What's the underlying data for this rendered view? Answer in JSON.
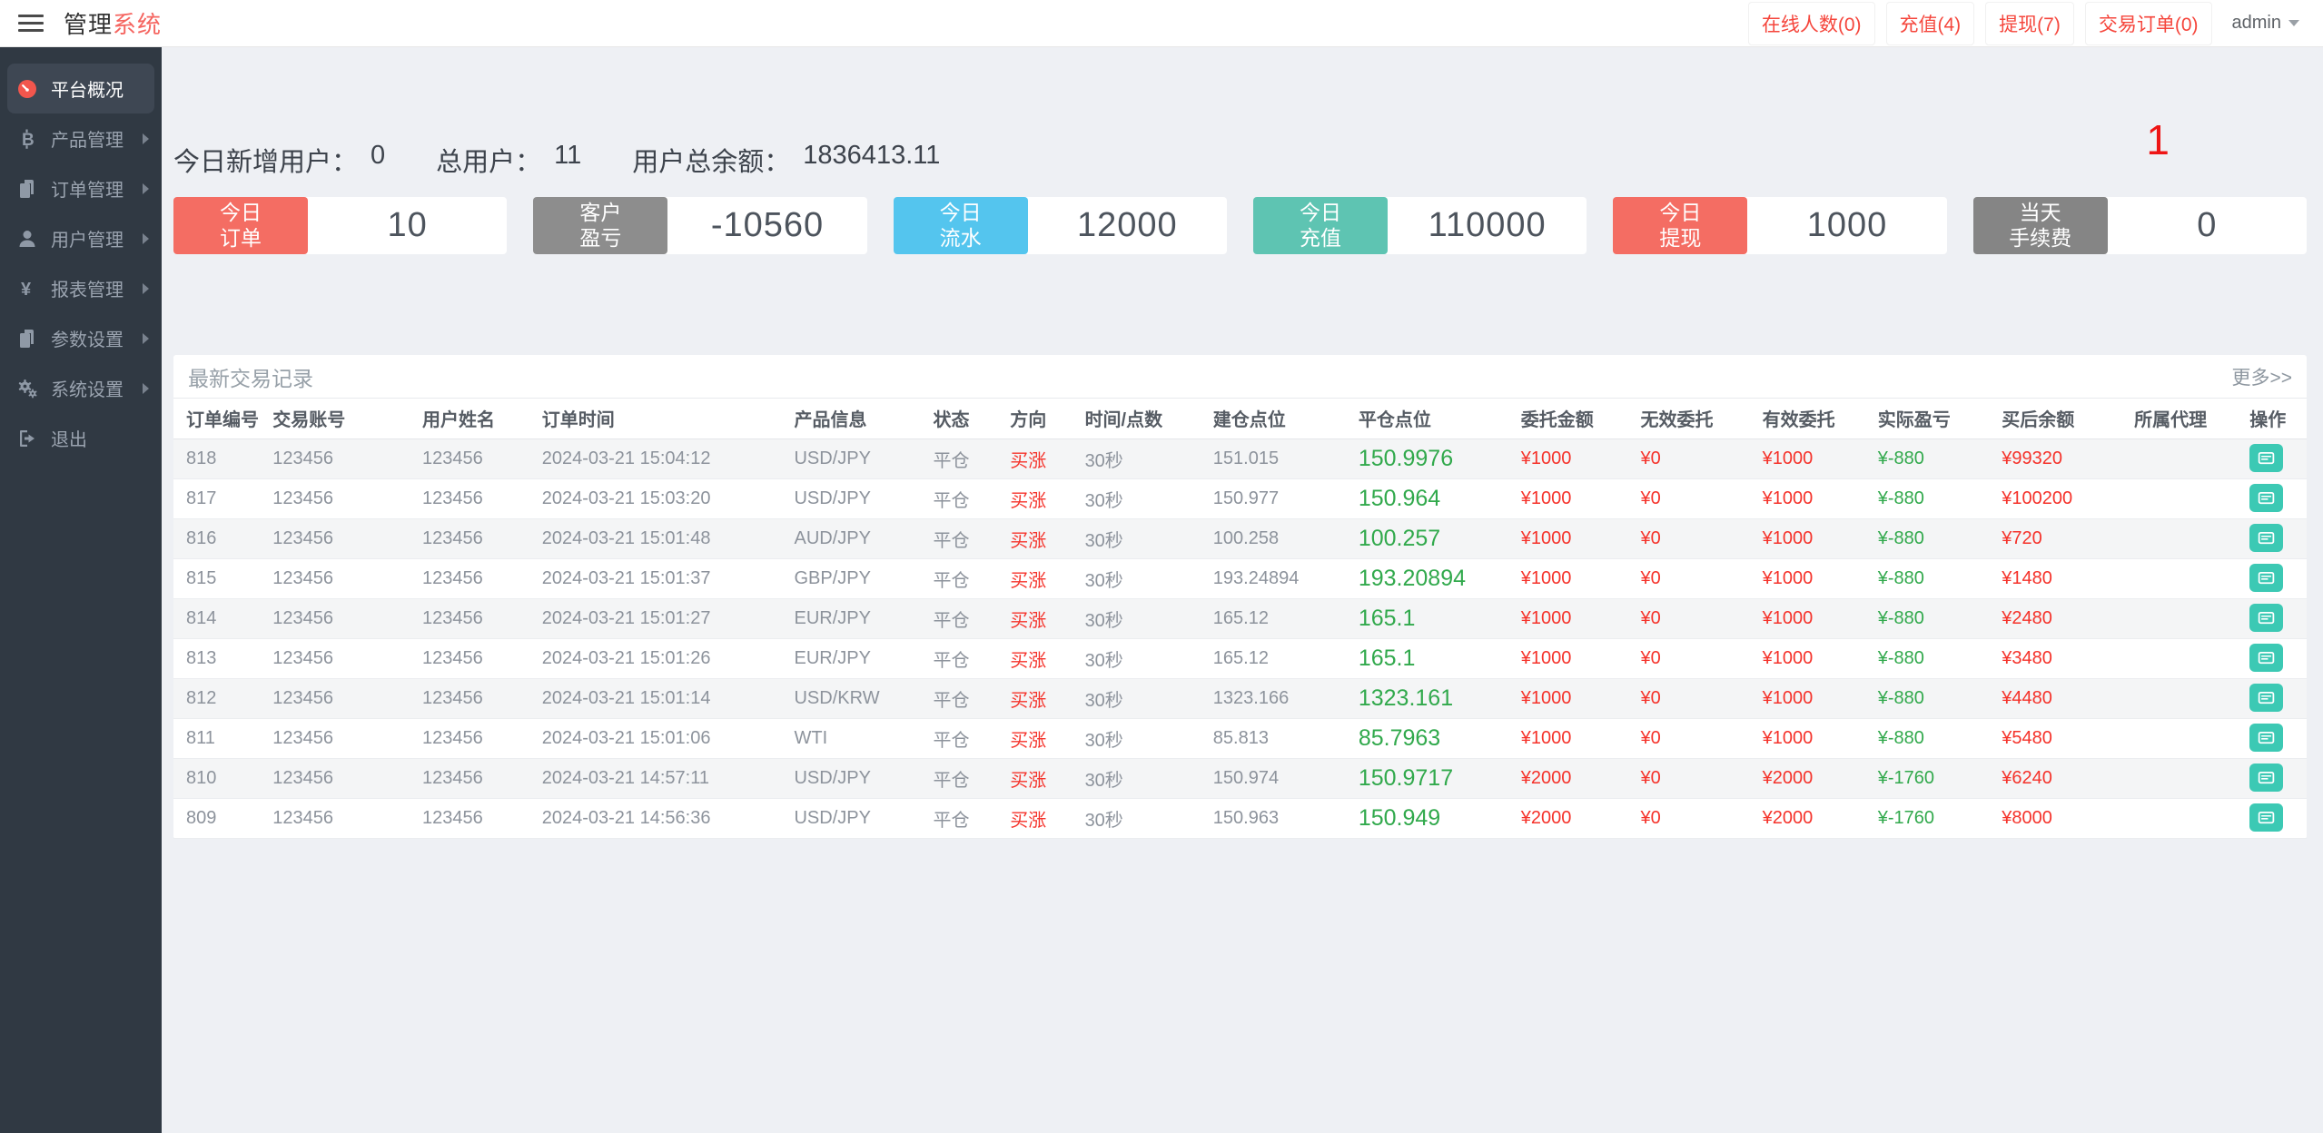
{
  "topbar": {
    "title_primary": "管理",
    "title_accent": "系统",
    "links": {
      "online": "在线人数(0)",
      "recharge": "充值(4)",
      "withdraw": "提现(7)",
      "orders": "交易订单(0)"
    },
    "user_menu": "admin"
  },
  "sidebar": {
    "items": [
      {
        "label": "平台概况",
        "icon": "dashboard-icon",
        "active": true
      },
      {
        "label": "产品管理",
        "icon": "bitcoin-icon",
        "active": false
      },
      {
        "label": "订单管理",
        "icon": "orders-icon",
        "active": false
      },
      {
        "label": "用户管理",
        "icon": "user-icon",
        "active": false
      },
      {
        "label": "报表管理",
        "icon": "yen-icon",
        "active": false
      },
      {
        "label": "参数设置",
        "icon": "params-icon",
        "active": false
      },
      {
        "label": "系统设置",
        "icon": "gear-icon",
        "active": false
      },
      {
        "label": "退出",
        "icon": "logout-icon",
        "active": false
      }
    ]
  },
  "overview": {
    "notification_badge": "1",
    "stats": [
      {
        "label": "今日新增用户：",
        "value": "0"
      },
      {
        "label": "总用户：",
        "value": "11"
      },
      {
        "label": "用户总余额：",
        "value": "1836413.11"
      }
    ],
    "cards": [
      {
        "line1": "今日",
        "line2": "订单",
        "value": "10",
        "color": "#f46d63"
      },
      {
        "line1": "客户",
        "line2": "盈亏",
        "value": "-10560",
        "color": "#8d8d8d"
      },
      {
        "line1": "今日",
        "line2": "流水",
        "value": "12000",
        "color": "#54c5ee"
      },
      {
        "line1": "今日",
        "line2": "充值",
        "value": "110000",
        "color": "#5ec4b2"
      },
      {
        "line1": "今日",
        "line2": "提现",
        "value": "1000",
        "color": "#f46d63"
      },
      {
        "line1": "当天",
        "line2": "手续费",
        "value": "0",
        "color": "#858585"
      }
    ]
  },
  "table": {
    "title": "最新交易记录",
    "more_link": "更多>>",
    "columns": [
      {
        "label": "订单编号"
      },
      {
        "label": "交易账号"
      },
      {
        "label": "用户姓名"
      },
      {
        "label": "订单时间"
      },
      {
        "label": "产品信息"
      },
      {
        "label": "状态"
      },
      {
        "label": "方向"
      },
      {
        "label": "时间/点数"
      },
      {
        "label": "建仓点位"
      },
      {
        "label": "平仓点位"
      },
      {
        "label": "委托金额"
      },
      {
        "label": "无效委托"
      },
      {
        "label": "有效委托"
      },
      {
        "label": "实际盈亏"
      },
      {
        "label": "买后余额"
      },
      {
        "label": "所属代理"
      },
      {
        "label": "操作"
      }
    ],
    "rows": [
      {
        "id": "818",
        "account": "123456",
        "name": "123456",
        "time": "2024-03-21 15:04:12",
        "product": "USD/JPY",
        "status": "平仓",
        "direction": "买涨",
        "period": "30秒",
        "open": "151.015",
        "close": "150.9976",
        "amount": "¥1000",
        "invalid": "¥0",
        "valid": "¥1000",
        "profit": "¥-880",
        "balance": "¥99320",
        "agent": ""
      },
      {
        "id": "817",
        "account": "123456",
        "name": "123456",
        "time": "2024-03-21 15:03:20",
        "product": "USD/JPY",
        "status": "平仓",
        "direction": "买涨",
        "period": "30秒",
        "open": "150.977",
        "close": "150.964",
        "amount": "¥1000",
        "invalid": "¥0",
        "valid": "¥1000",
        "profit": "¥-880",
        "balance": "¥100200",
        "agent": ""
      },
      {
        "id": "816",
        "account": "123456",
        "name": "123456",
        "time": "2024-03-21 15:01:48",
        "product": "AUD/JPY",
        "status": "平仓",
        "direction": "买涨",
        "period": "30秒",
        "open": "100.258",
        "close": "100.257",
        "amount": "¥1000",
        "invalid": "¥0",
        "valid": "¥1000",
        "profit": "¥-880",
        "balance": "¥720",
        "agent": ""
      },
      {
        "id": "815",
        "account": "123456",
        "name": "123456",
        "time": "2024-03-21 15:01:37",
        "product": "GBP/JPY",
        "status": "平仓",
        "direction": "买涨",
        "period": "30秒",
        "open": "193.24894",
        "close": "193.20894",
        "amount": "¥1000",
        "invalid": "¥0",
        "valid": "¥1000",
        "profit": "¥-880",
        "balance": "¥1480",
        "agent": ""
      },
      {
        "id": "814",
        "account": "123456",
        "name": "123456",
        "time": "2024-03-21 15:01:27",
        "product": "EUR/JPY",
        "status": "平仓",
        "direction": "买涨",
        "period": "30秒",
        "open": "165.12",
        "close": "165.1",
        "amount": "¥1000",
        "invalid": "¥0",
        "valid": "¥1000",
        "profit": "¥-880",
        "balance": "¥2480",
        "agent": ""
      },
      {
        "id": "813",
        "account": "123456",
        "name": "123456",
        "time": "2024-03-21 15:01:26",
        "product": "EUR/JPY",
        "status": "平仓",
        "direction": "买涨",
        "period": "30秒",
        "open": "165.12",
        "close": "165.1",
        "amount": "¥1000",
        "invalid": "¥0",
        "valid": "¥1000",
        "profit": "¥-880",
        "balance": "¥3480",
        "agent": ""
      },
      {
        "id": "812",
        "account": "123456",
        "name": "123456",
        "time": "2024-03-21 15:01:14",
        "product": "USD/KRW",
        "status": "平仓",
        "direction": "买涨",
        "period": "30秒",
        "open": "1323.166",
        "close": "1323.161",
        "amount": "¥1000",
        "invalid": "¥0",
        "valid": "¥1000",
        "profit": "¥-880",
        "balance": "¥4480",
        "agent": ""
      },
      {
        "id": "811",
        "account": "123456",
        "name": "123456",
        "time": "2024-03-21 15:01:06",
        "product": "WTI",
        "status": "平仓",
        "direction": "买涨",
        "period": "30秒",
        "open": "85.813",
        "close": "85.7963",
        "amount": "¥1000",
        "invalid": "¥0",
        "valid": "¥1000",
        "profit": "¥-880",
        "balance": "¥5480",
        "agent": ""
      },
      {
        "id": "810",
        "account": "123456",
        "name": "123456",
        "time": "2024-03-21 14:57:11",
        "product": "USD/JPY",
        "status": "平仓",
        "direction": "买涨",
        "period": "30秒",
        "open": "150.974",
        "close": "150.9717",
        "amount": "¥2000",
        "invalid": "¥0",
        "valid": "¥2000",
        "profit": "¥-1760",
        "balance": "¥6240",
        "agent": ""
      },
      {
        "id": "809",
        "account": "123456",
        "name": "123456",
        "time": "2024-03-21 14:56:36",
        "product": "USD/JPY",
        "status": "平仓",
        "direction": "买涨",
        "period": "30秒",
        "open": "150.963",
        "close": "150.949",
        "amount": "¥2000",
        "invalid": "¥0",
        "valid": "¥2000",
        "profit": "¥-1760",
        "balance": "¥8000",
        "agent": ""
      }
    ]
  },
  "colors": {
    "accent_red": "#f5463c",
    "value_red": "#f5322a",
    "value_green": "#31a94c",
    "action_teal": "#3cc9b4",
    "sidebar_bg": "#303943"
  }
}
